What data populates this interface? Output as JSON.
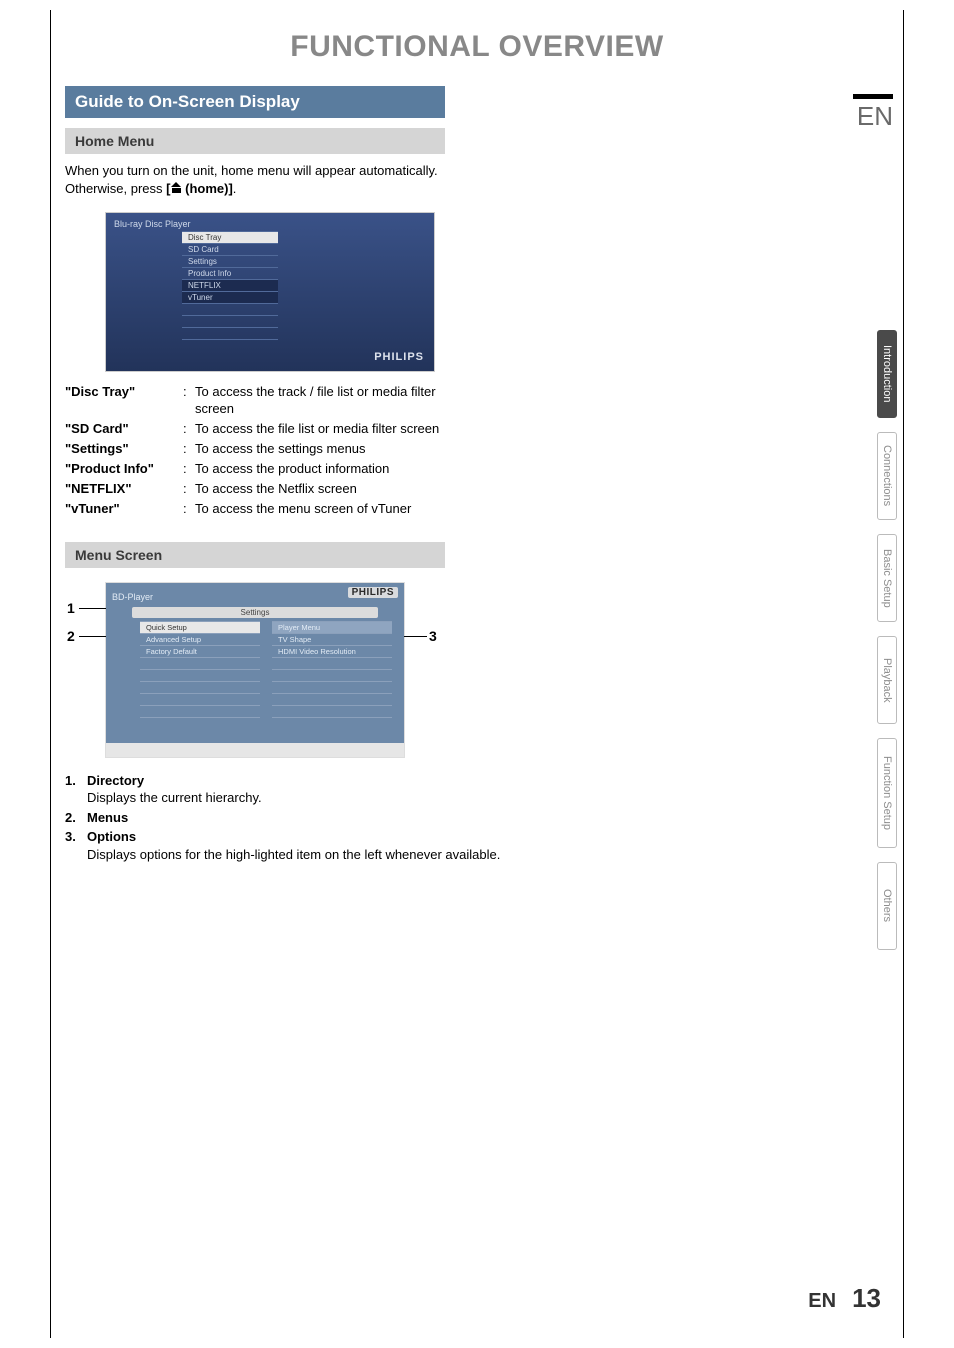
{
  "page": {
    "title": "FUNCTIONAL OVERVIEW",
    "lang_badge": "EN",
    "footer_lang": "EN",
    "footer_page": "13"
  },
  "section": {
    "guide_header": "Guide to On-Screen Display"
  },
  "home_menu": {
    "header": "Home Menu",
    "intro_a": "When you turn on the unit, home menu will appear automatically. Otherwise, press ",
    "intro_b": "[",
    "intro_c": " (home)]",
    "intro_end": "."
  },
  "hm_shot": {
    "title": "Blu-ray Disc Player",
    "items": [
      "Disc Tray",
      "SD Card",
      "Settings",
      "Product Info",
      "NETFLIX",
      "vTuner"
    ],
    "brand": "PHILIPS"
  },
  "definitions": [
    {
      "term": "\"Disc Tray\"",
      "def": "To access the track / file list or media filter screen"
    },
    {
      "term": "\"SD Card\"",
      "def": "To access the file list or media filter screen"
    },
    {
      "term": "\"Settings\"",
      "def": "To access the settings menus"
    },
    {
      "term": "\"Product Info\"",
      "def": "To access the product information"
    },
    {
      "term": "\"NETFLIX\"",
      "def": "To access the Netflix screen"
    },
    {
      "term": "\"vTuner\"",
      "def": "To access the menu screen of vTuner"
    }
  ],
  "menu_screen": {
    "header": "Menu Screen",
    "bd": "BD-Player",
    "brand": "PHILIPS",
    "dir": "Settings",
    "left_items": [
      "Quick Setup",
      "Advanced Setup",
      "Factory Default"
    ],
    "right_items": [
      "Player Menu",
      "TV Shape",
      "HDMI Video Resolution"
    ],
    "callout1": "1",
    "callout2": "2",
    "callout3": "3"
  },
  "notes": [
    {
      "num": "1.",
      "label": "Directory",
      "desc": "Displays the current hierarchy."
    },
    {
      "num": "2.",
      "label": "Menus",
      "desc": ""
    },
    {
      "num": "3.",
      "label": "Options",
      "desc": "Displays options for the high-lighted item on the left whenever available."
    }
  ],
  "tabs": {
    "introduction": "Introduction",
    "connections": "Connections",
    "basic_setup": "Basic Setup",
    "playback": "Playback",
    "function_setup": "Function Setup",
    "others": "Others"
  }
}
